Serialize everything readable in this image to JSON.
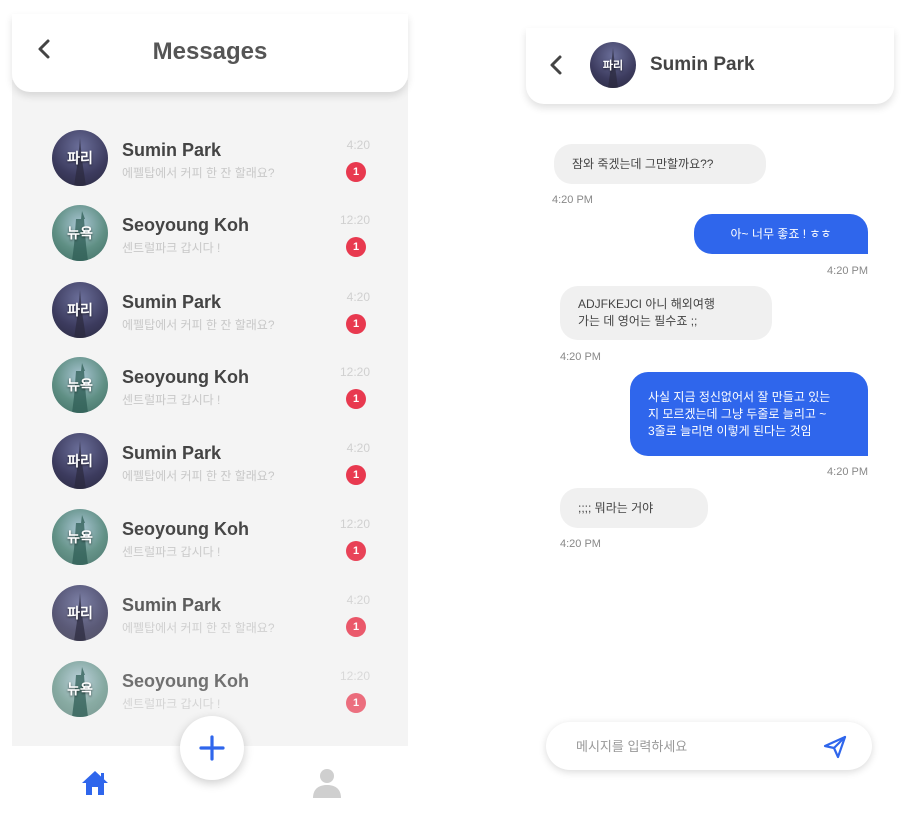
{
  "colors": {
    "accent": "#2f66ec",
    "badge": "#e8394f",
    "list_bg": "#f4f4f4"
  },
  "messages_screen": {
    "title": "Messages",
    "back_icon": "chevron-left-icon",
    "conversations": [
      {
        "avatar_text": "파리",
        "name": "Sumin Park",
        "preview": "에펠탑에서 커피 한 잔 할래요?",
        "time": "4:20",
        "unread": "1"
      },
      {
        "avatar_text": "뉴욕",
        "name": "Seoyoung Koh",
        "preview": "센트럴파크 갑시다 !",
        "time": "12:20",
        "unread": "1"
      },
      {
        "avatar_text": "파리",
        "name": "Sumin Park",
        "preview": "에펠탑에서 커피 한 잔 할래요?",
        "time": "4:20",
        "unread": "1"
      },
      {
        "avatar_text": "뉴욕",
        "name": "Seoyoung Koh",
        "preview": "센트럴파크 갑시다 !",
        "time": "12:20",
        "unread": "1"
      },
      {
        "avatar_text": "파리",
        "name": "Sumin Park",
        "preview": "에펠탑에서 커피 한 잔 할래요?",
        "time": "4:20",
        "unread": "1"
      },
      {
        "avatar_text": "뉴욕",
        "name": "Seoyoung Koh",
        "preview": "센트럴파크 갑시다 !",
        "time": "12:20",
        "unread": "1"
      },
      {
        "avatar_text": "파리",
        "name": "Sumin Park",
        "preview": "에펠탑에서 커피 한 잔 할래요?",
        "time": "4:20",
        "unread": "1"
      },
      {
        "avatar_text": "뉴욕",
        "name": "Seoyoung Koh",
        "preview": "센트럴파크 갑시다 !",
        "time": "12:20",
        "unread": "1"
      }
    ],
    "fab_icon": "plus-icon",
    "nav": {
      "home_icon": "home-icon",
      "profile_icon": "user-icon"
    }
  },
  "chat_screen": {
    "back_icon": "chevron-left-icon",
    "contact": {
      "avatar_text": "파리",
      "name": "Sumin Park"
    },
    "messages": [
      {
        "direction": "in",
        "lines": [
          "잠와 죽겠는데 그만할까요??"
        ],
        "time": "4:20 PM"
      },
      {
        "direction": "out",
        "lines": [
          "아~ 너무 좋죠 ! ㅎㅎ"
        ],
        "time": "4:20 PM"
      },
      {
        "direction": "in",
        "lines": [
          "ADJFKEJCI 아니 해외여행",
          "가는 데 영어는 필수죠 ;;"
        ],
        "time": "4:20 PM"
      },
      {
        "direction": "out",
        "lines": [
          "사실 지금 정신없어서 잘 만들고 있는",
          "지 모르겠는데 그냥 두줄로 늘리고 ~",
          "3줄로 늘리면 이렇게 된다는 것임"
        ],
        "time": "4:20 PM"
      },
      {
        "direction": "in",
        "lines": [
          ";;;; 뭐라는 거야"
        ],
        "time": "4:20 PM"
      }
    ],
    "input": {
      "placeholder": "메시지를 입력하세요",
      "value": ""
    },
    "send_icon": "send-icon"
  }
}
